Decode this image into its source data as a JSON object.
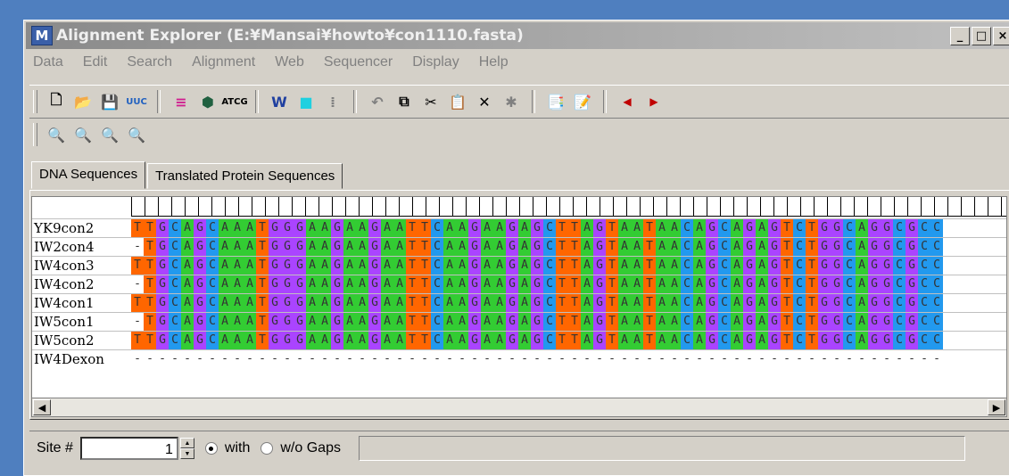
{
  "window": {
    "title": "Alignment Explorer (E:¥Mansai¥howto¥con1110.fasta)",
    "app_icon": "M"
  },
  "menu": [
    "Data",
    "Edit",
    "Search",
    "Alignment",
    "Web",
    "Sequencer",
    "Display",
    "Help"
  ],
  "toolbar1": [
    "new-file-icon",
    "open-folder-icon",
    "save-icon",
    "translate-icon",
    "align-icon",
    "align-web-icon",
    "dna-icon",
    "wizard-icon",
    "mark-site-icon",
    "sequence-icon",
    "undo-icon",
    "copy-icon",
    "cut-icon",
    "paste-icon",
    "delete-icon",
    "delete-gaps-icon",
    "insert-icon",
    "append-icon",
    "prev-icon",
    "next-icon"
  ],
  "toolbar2": [
    "find-icon",
    "find-prev-icon",
    "find-next-icon",
    "find-marked-icon"
  ],
  "tabs": [
    "DNA Sequences",
    "Translated Protein Sequences"
  ],
  "sequence_names": [
    "YK9con2",
    "IW2con4",
    "IW4con3",
    "IW4con2",
    "IW4con1",
    "IW5con1",
    "IW5con2",
    "IW4Dexon"
  ],
  "sequences": [
    "TTGCAGCAAATGGGAAGAAGAATTCAAGAAGAGCTTAGTAATAACAGCAGAGTCTGGCAGGCGCC",
    "-TGCAGCAAATGGGAAGAAGAATTCAAGAAGAGCTTAGTAATAACAGCAGAGTCTGGCAGGCGCC",
    "TTGCAGCAAATGGGAAGAAGAATTCAAGAAGAGCTTAGTAATAACAGCAGAGTCTGGCAGGCGCC",
    "-TGCAGCAAATGGGAAGAAGAATTCAAGAAGAGCTTAGTAATAACAGCAGAGTCTGGCAGGCGCC",
    "TTGCAGCAAATGGGAAGAAGAATTCAAGAAGAGCTTAGTAATAACAGCAGAGTCTGGCAGGCGCC",
    "-TGCAGCAAATGGGAAGAAGAATTCAAGAAGAGCTTAGTAATAACAGCAGAGTCTGGCAGGCGCC",
    "TTGCAGCAAATGGGAAGAAGAATTCAAGAAGAGCTTAGTAATAACAGCAGAGTCTGGCAGGCGCC",
    "-----------------------------------------------------------------"
  ],
  "base_colors": {
    "A": "#33cc33",
    "T": "#ff6600",
    "G": "#aa44ff",
    "C": "#2299ee",
    "-": "#ffffff"
  },
  "status": {
    "site_label": "Site #",
    "site_value": "1",
    "with_label": "with",
    "without_label": "w/o Gaps"
  }
}
